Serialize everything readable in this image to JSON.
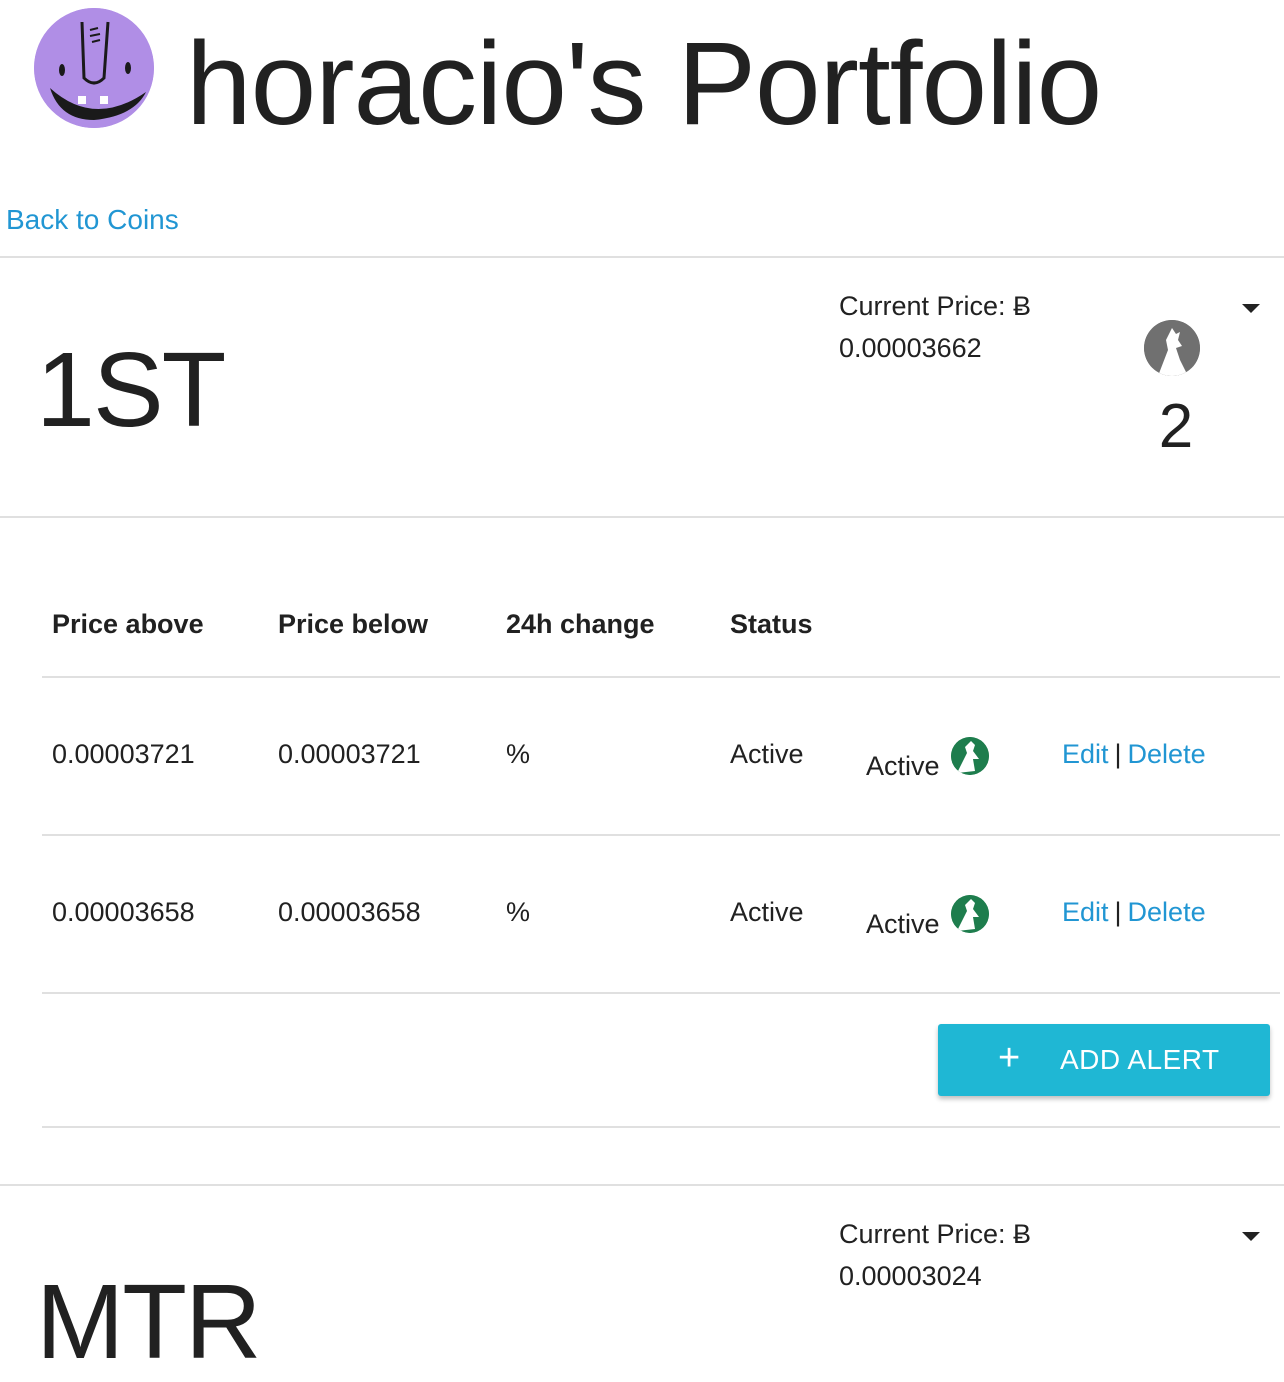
{
  "header": {
    "title": "horacio's Portfolio",
    "avatar_icon": "monster-avatar-icon",
    "avatar_color": "#b08ee6"
  },
  "nav": {
    "back_link": "Back to Coins"
  },
  "coins": [
    {
      "symbol": "1ST",
      "price_label": "Current Price: Ƀ",
      "price_value": "0.00003662",
      "alert_count": "2",
      "badge_icon": "howling-wolf-icon",
      "table": {
        "headers": [
          "Price above",
          "Price below",
          "24h change",
          "Status"
        ],
        "rows": [
          {
            "price_above": "0.00003721",
            "price_below": "0.00003721",
            "change_24h": "%",
            "status": "Active",
            "status_label": "Active",
            "status_icon": "tree-icon",
            "edit": "Edit",
            "separator": "|",
            "delete": "Delete"
          },
          {
            "price_above": "0.00003658",
            "price_below": "0.00003658",
            "change_24h": "%",
            "status": "Active",
            "status_label": "Active",
            "status_icon": "tree-icon",
            "edit": "Edit",
            "separator": "|",
            "delete": "Delete"
          }
        ]
      },
      "add_alert": {
        "icon": "+",
        "label": "ADD ALERT"
      }
    },
    {
      "symbol": "MTR",
      "price_label": "Current Price: Ƀ",
      "price_value": "0.00003024"
    }
  ],
  "colors": {
    "link": "#2196d3",
    "button": "#1fb7d4",
    "status_icon": "#1e7d4d",
    "badge": "#707070",
    "divider": "#e0e0e0"
  }
}
